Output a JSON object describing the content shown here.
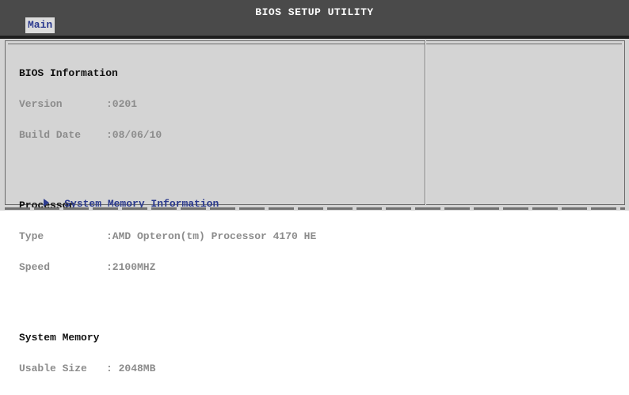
{
  "app": {
    "title": "BIOS SETUP UTILITY"
  },
  "tabs": [
    {
      "label": "Main",
      "active": true
    }
  ],
  "bios_information": {
    "title": "BIOS Information",
    "rows": [
      {
        "label": "Version",
        "value": ":0201"
      },
      {
        "label": "Build Date",
        "value": ":08/06/10"
      }
    ]
  },
  "processor": {
    "title": "Processor",
    "rows": [
      {
        "label": "Type",
        "value": ":AMD Opteron(tm) Processor 4170 HE"
      },
      {
        "label": "Speed",
        "value": ":2100MHZ"
      }
    ]
  },
  "system_memory": {
    "title": "System Memory",
    "rows": [
      {
        "label": "Usable Size",
        "value": ": 2048MB"
      }
    ]
  },
  "links": [
    {
      "label": "System Memory Information",
      "icon": "arrow-right-icon"
    }
  ],
  "colors": {
    "background": "#d4d4d4",
    "topbar": "#4a4a4a",
    "accent": "#2b3a8e",
    "label": "#8c8c8c",
    "section": "#111111"
  }
}
